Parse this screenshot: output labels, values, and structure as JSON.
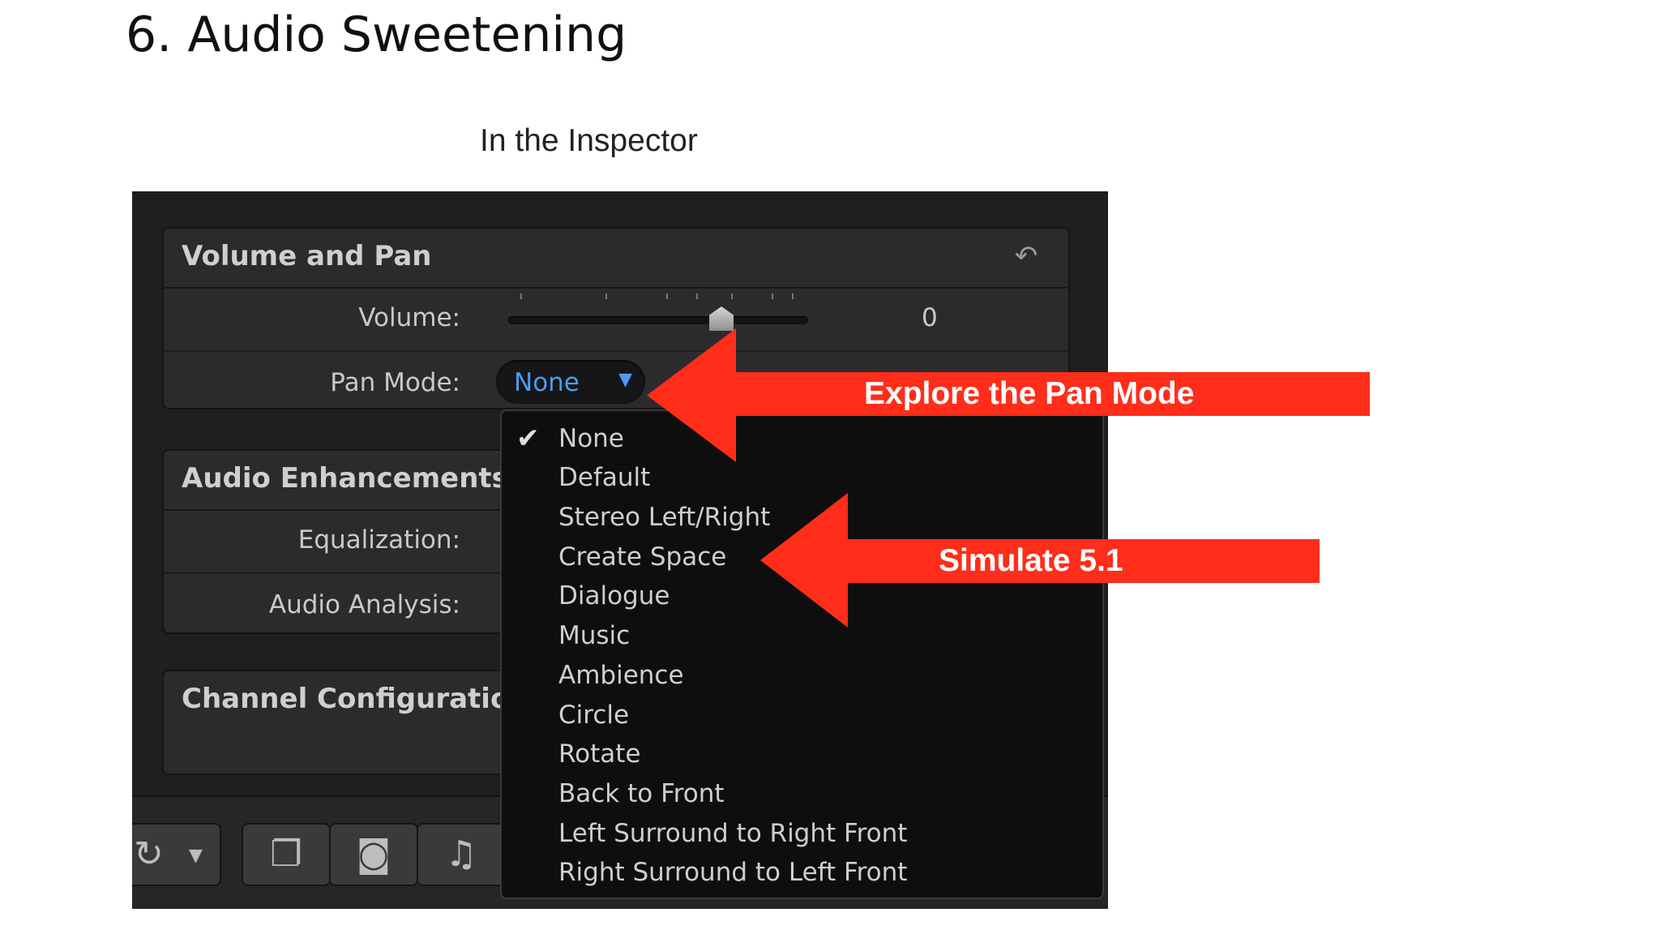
{
  "slide": {
    "title": "6. Audio Sweetening",
    "subtitle": "In the Inspector"
  },
  "volume_and_pan": {
    "title": "Volume and Pan",
    "reset_icon": "reset-arrow-icon",
    "volume_label": "Volume:",
    "volume_value": "0",
    "pan_mode_label": "Pan Mode:",
    "pan_mode_value": "None"
  },
  "audio_enhancements": {
    "title": "Audio Enhancements",
    "equalization_label": "Equalization:",
    "audio_analysis_label": "Audio Analysis:"
  },
  "channel_configuration": {
    "title": "Channel Configuratio"
  },
  "pan_menu": {
    "selected": "None",
    "items": [
      "None",
      "Default",
      "Stereo Left/Right",
      "Create Space",
      "Dialogue",
      "Music",
      "Ambience",
      "Circle",
      "Rotate",
      "Back to Front",
      "Left Surround to Right Front",
      "Right Surround to Left Front"
    ]
  },
  "toolbar": {
    "icons": [
      "enhance-icon",
      "dropdown-caret-icon",
      "browser-icon",
      "photo-icon",
      "music-icon"
    ]
  },
  "annotations": {
    "explore": "Explore the Pan Mode",
    "simulate": "Simulate 5.1",
    "color": "#ff2d1a"
  },
  "colors": {
    "accent": "#4b9cf0",
    "panel": "#1f1f20"
  }
}
